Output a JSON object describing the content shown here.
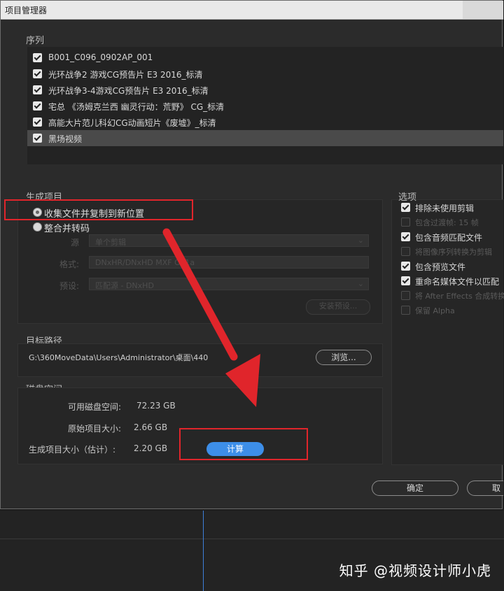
{
  "dialog": {
    "title": "项目管理器",
    "sequences_label": "序列",
    "sequences": [
      {
        "label": "B001_C096_0902AP_001",
        "checked": true
      },
      {
        "label": "光环战争2 游戏CG预告片 E3 2016_标清",
        "checked": true
      },
      {
        "label": "光环战争3-4游戏CG预告片 E3 2016_标清",
        "checked": true
      },
      {
        "label": "宅总 《汤姆克兰西 幽灵行动：荒野》 CG_标清",
        "checked": true
      },
      {
        "label": "高能大片范儿科幻CG动画短片《废墟》_标清",
        "checked": true
      },
      {
        "label": "黑场视频",
        "checked": true,
        "selected": true
      }
    ],
    "generate": {
      "label": "生成项目",
      "option_collect": "收集文件并复制到新位置",
      "option_consolidate": "整合并转码",
      "source_label": "源",
      "source_value": "单个剪辑",
      "format_label": "格式:",
      "format_value": "DNxHR/DNxHD MXF OP1a",
      "preset_label": "预设:",
      "preset_value": "匹配源 - DNxHD",
      "import_preset_button": "安装预设..."
    },
    "options": {
      "label": "选项",
      "items": [
        {
          "label": "排除未使用剪辑",
          "checked": true,
          "enabled": true
        },
        {
          "label": "包含过渡帧: 15 帧",
          "checked": false,
          "enabled": false
        },
        {
          "label": "包含音频匹配文件",
          "checked": true,
          "enabled": true
        },
        {
          "label": "将图像序列转换为剪辑",
          "checked": false,
          "enabled": false
        },
        {
          "label": "包含预览文件",
          "checked": true,
          "enabled": true
        },
        {
          "label": "重命名媒体文件以匹配",
          "checked": true,
          "enabled": true
        },
        {
          "label": "将 After Effects 合成转换",
          "checked": false,
          "enabled": false
        },
        {
          "label": "保留 Alpha",
          "checked": false,
          "enabled": false
        }
      ]
    },
    "destination": {
      "label": "目标路径",
      "path": "G:\\360MoveData\\Users\\Administrator\\桌面\\440",
      "browse_button": "浏览..."
    },
    "disk": {
      "label": "磁盘空间",
      "available_label": "可用磁盘空间:",
      "available_value": "72.23 GB",
      "original_label": "原始项目大小:",
      "original_value": "2.66 GB",
      "generated_label": "生成项目大小（估计）:",
      "generated_value": "2.20 GB",
      "calculate_button": "计算"
    },
    "ok_button": "确定",
    "cancel_button": "取"
  },
  "watermark": "知乎 @视频设计师小虎",
  "colors": {
    "dialog_bg": "#2b2b2b",
    "accent_blue": "#3d8ee8",
    "annotation_red": "#e0252b"
  }
}
